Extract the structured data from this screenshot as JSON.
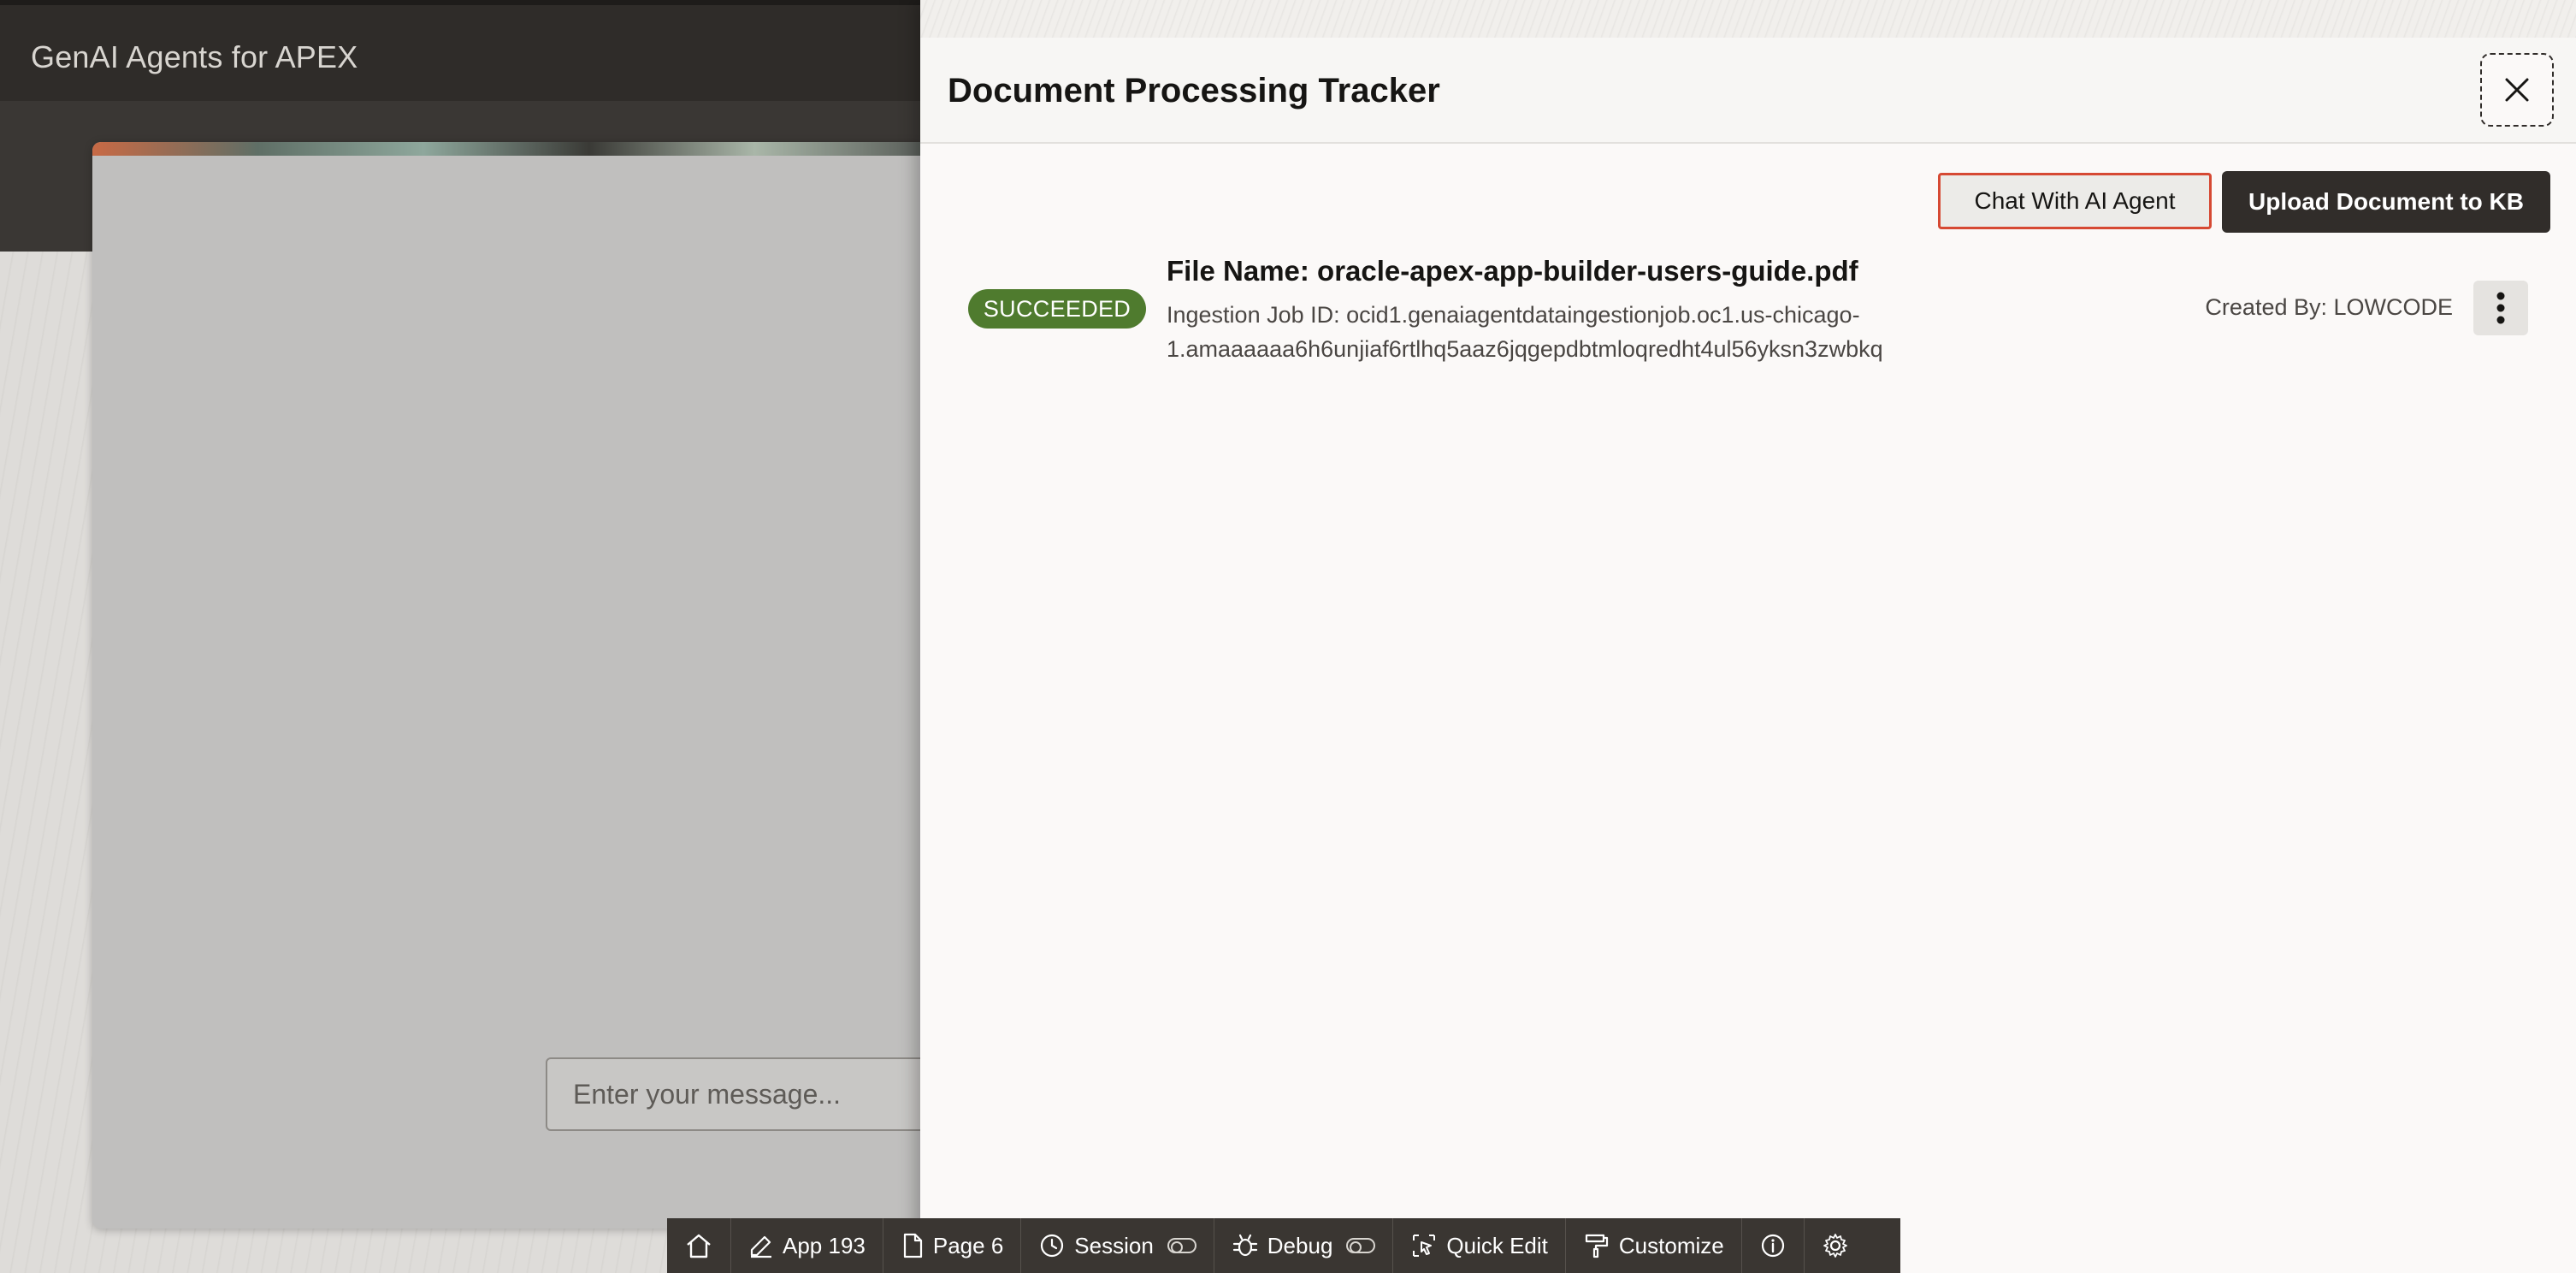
{
  "app": {
    "title": "GenAI Agents for APEX"
  },
  "chat": {
    "placeholder": "Enter your message..."
  },
  "panel": {
    "title": "Document Processing Tracker",
    "buttons": {
      "chat": "Chat With AI Agent",
      "upload": "Upload Document to KB"
    },
    "items": [
      {
        "status": "SUCCEEDED",
        "file_name": "File Name: oracle-apex-app-builder-users-guide.pdf",
        "job_line_1": "Ingestion Job ID: ocid1.genaiagentdataingestionjob.oc1.us-chicago-",
        "job_line_2": "1.amaaaaaa6h6unjiaf6rtlhq5aaz6jqgepdbtmloqredht4ul56yksn3zwbkq",
        "created_by": "Created By: LOWCODE"
      }
    ]
  },
  "toolbar": {
    "app": "App 193",
    "page": "Page 6",
    "session": "Session",
    "debug": "Debug",
    "quick_edit": "Quick Edit",
    "customize": "Customize"
  },
  "colors": {
    "accent_border": "#d64933",
    "success": "#4f7b2e",
    "dark": "#312d2a"
  }
}
